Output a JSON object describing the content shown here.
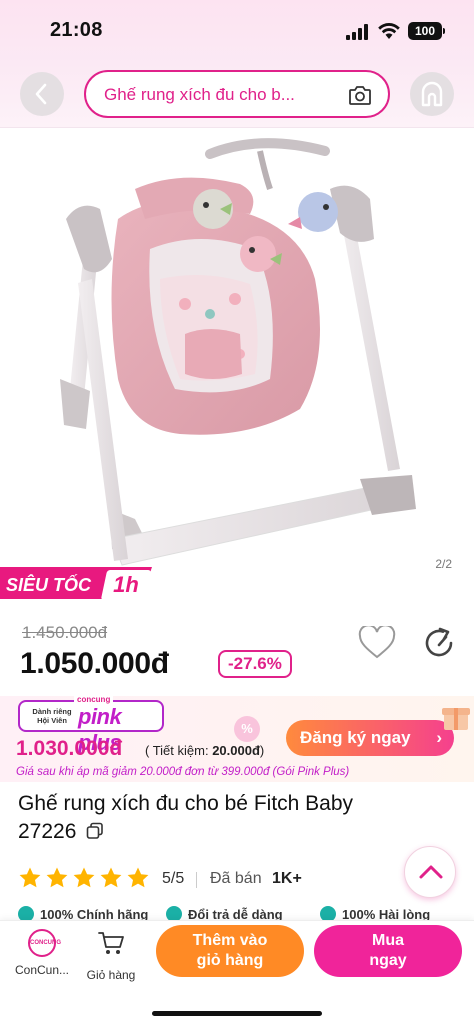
{
  "status_bar": {
    "time": "21:08",
    "battery": "100"
  },
  "nav": {
    "search_text": "Ghế rung xích đu cho b..."
  },
  "gallery": {
    "counter": "2/2"
  },
  "badge": {
    "speed_label": "SIÊU TỐC",
    "speed_time": "1h"
  },
  "price": {
    "original": "1.450.000đ",
    "current": "1.050.000đ",
    "discount": "-27.6%"
  },
  "pink_plus": {
    "brand_top": "concung",
    "exclusive_label": "Dành riêng Hội Viên",
    "logo_text": "pink plus",
    "price": "1.030.000đ",
    "save_prefix": "( Tiết kiệm: ",
    "save_amount": "20.000đ",
    "save_suffix": ")",
    "note": "Giá sau khi áp mã giảm 20.000đ đơn từ 399.000đ (Gói Pink Plus)",
    "badge": "%",
    "register_label": "Đăng ký ngay",
    "register_chevron": "›"
  },
  "product": {
    "title": "Ghế rung xích đu cho bé Fitch Baby 27226",
    "rating_value": 5,
    "rating": "5/5",
    "sold_label": "Đã bán",
    "sold_count": "1K+"
  },
  "guarantees": [
    "100% Chính hãng",
    "Đổi trả dễ dàng",
    "100% Hài lòng"
  ],
  "bottom_bar": {
    "store_logo": "CONCUNG",
    "store_label": "ConCun...",
    "cart_label": "Giỏ hàng",
    "add_cart_line1": "Thêm vào",
    "add_cart_line2": "giỏ hàng",
    "buy_line1": "Mua",
    "buy_line2": "ngay"
  },
  "colors": {
    "brand_pink": "#e0218a",
    "orange": "#ff8a25",
    "purple": "#c21ec8"
  },
  "icons": [
    "back-icon",
    "home-icon",
    "camera-icon",
    "heart-icon",
    "share-icon",
    "gift-icon",
    "copy-icon",
    "star-icon",
    "chevron-up-icon",
    "cart-icon"
  ]
}
